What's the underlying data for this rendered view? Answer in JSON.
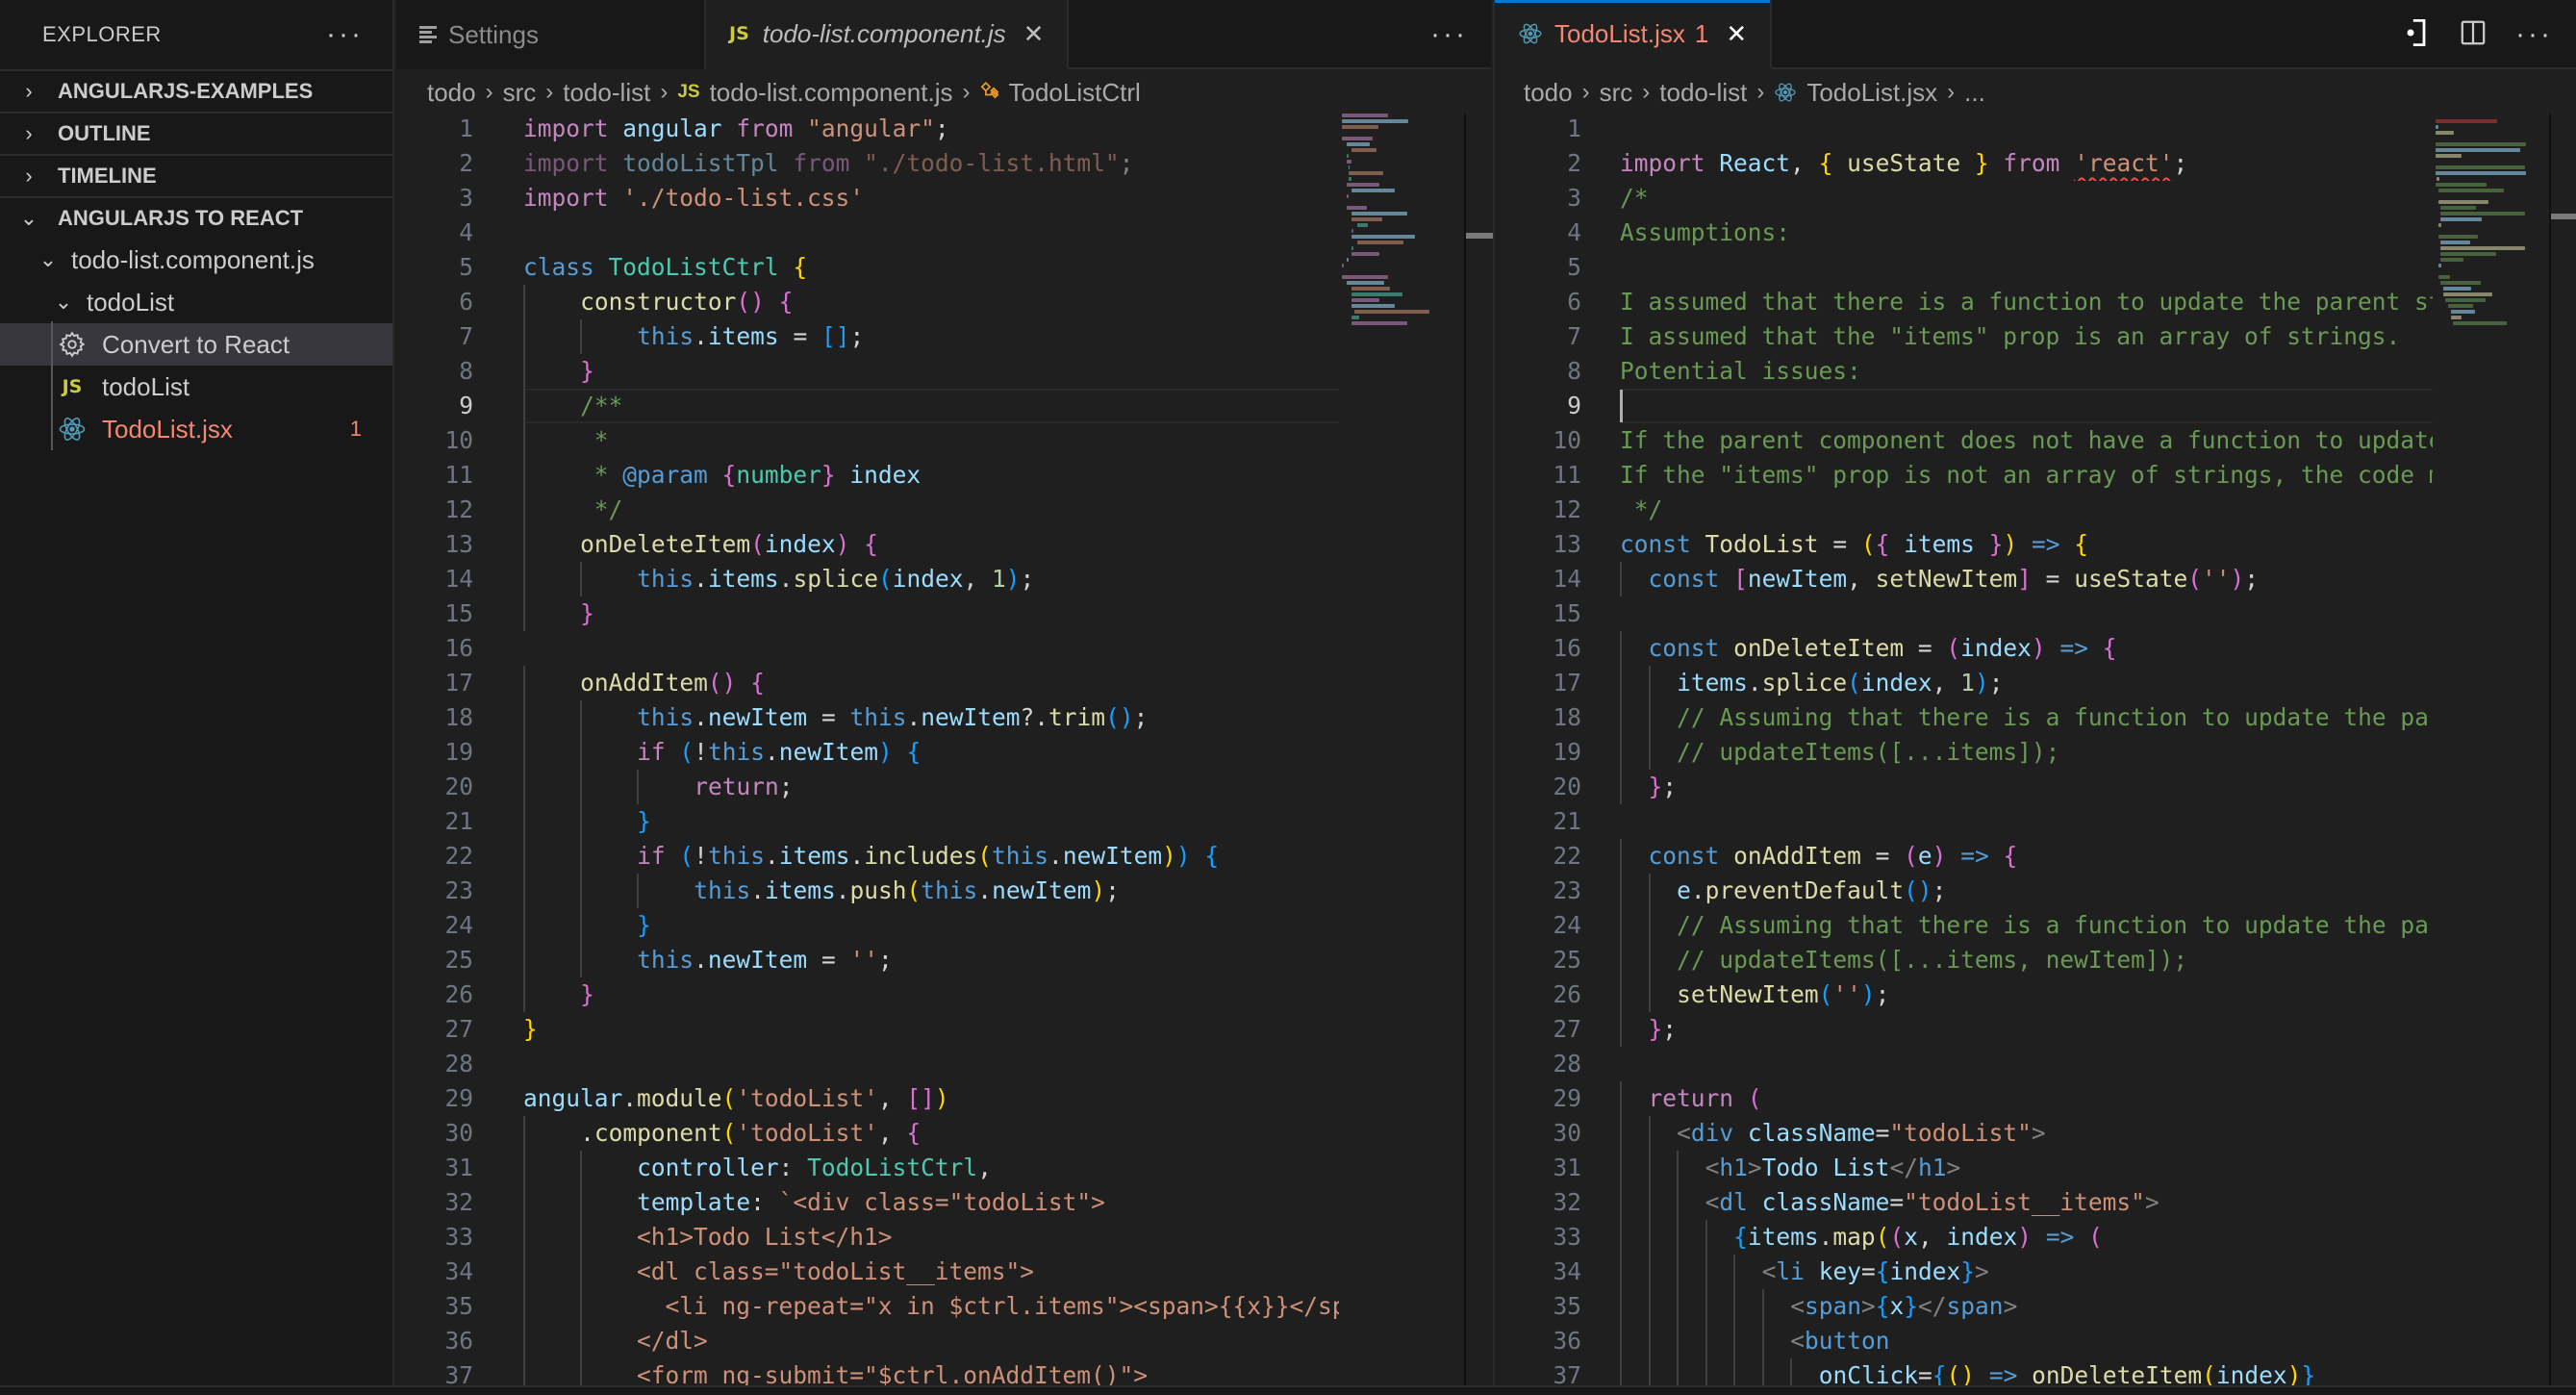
{
  "sidebar": {
    "title": "EXPLORER",
    "more_label": "···",
    "sections": [
      {
        "label": "ANGULARJS-EXAMPLES",
        "expanded": false
      },
      {
        "label": "OUTLINE",
        "expanded": false
      },
      {
        "label": "TIMELINE",
        "expanded": false
      },
      {
        "label": "ANGULARJS TO REACT",
        "expanded": true
      }
    ],
    "tree": [
      {
        "label": "todo-list.component.js",
        "icon": "chevron-down-icon",
        "level": 1
      },
      {
        "label": "todoList",
        "icon": "chevron-down-icon",
        "level": 2
      },
      {
        "label": "Convert to React",
        "icon": "gear-icon",
        "level": 3,
        "selected": true
      },
      {
        "label": "todoList",
        "icon": "js-file-icon",
        "icon_text": "JS",
        "level": 3
      },
      {
        "label": "TodoList.jsx",
        "icon": "react-icon",
        "level": 3,
        "error": true,
        "badge": "1"
      }
    ]
  },
  "left_editor": {
    "tabs": [
      {
        "label": "Settings",
        "icon": "settings-icon",
        "active": false
      },
      {
        "label": "todo-list.component.js",
        "icon": "js-file-icon",
        "icon_text": "JS",
        "active": true,
        "italic": true,
        "close": "✕"
      }
    ],
    "more_label": "···",
    "breadcrumb": [
      "todo",
      "src",
      "todo-list",
      "todo-list.component.js",
      "TodoListCtrl"
    ],
    "current_line": 9,
    "lines": [
      "import angular from \"angular\";",
      "import todoListTpl from \"./todo-list.html\";",
      "import './todo-list.css'",
      "",
      "class TodoListCtrl {",
      "    constructor() {",
      "        this.items = [];",
      "    }",
      "    /**",
      "     *",
      "     * @param {number} index",
      "     */",
      "    onDeleteItem(index) {",
      "        this.items.splice(index, 1);",
      "    }",
      "",
      "    onAddItem() {",
      "        this.newItem = this.newItem?.trim();",
      "        if (!this.newItem) {",
      "            return;",
      "        }",
      "        if (!this.items.includes(this.newItem)) {",
      "            this.items.push(this.newItem);",
      "        }",
      "        this.newItem = '';",
      "    }",
      "}",
      "",
      "angular.module('todoList', [])",
      "    .component('todoList', {",
      "        controller: TodoListCtrl,",
      "        template: `<div class=\"todoList\">",
      "        <h1>Todo List</h1>",
      "        <dl class=\"todoList__items\">",
      "          <li ng-repeat=\"x in $ctrl.items\"><span>{{x}}</spa",
      "        </dl>",
      "        <form ng-submit=\"$ctrl.onAddItem()\">"
    ]
  },
  "right_editor": {
    "tabs": [
      {
        "label": "TodoList.jsx",
        "icon": "react-icon",
        "active": true,
        "error_count": "1",
        "close": "✕"
      }
    ],
    "actions": [
      {
        "name": "open-changes-icon"
      },
      {
        "name": "split-editor-icon"
      },
      {
        "name": "more-actions-icon",
        "label": "···"
      }
    ],
    "breadcrumb": [
      "todo",
      "src",
      "todo-list",
      "TodoList.jsx",
      "..."
    ],
    "current_line": 9,
    "lines": [
      "",
      "import React, { useState } from 'react';",
      "/*",
      "Assumptions:",
      "",
      "I assumed that there is a function to update the parent sta",
      "I assumed that the \"items\" prop is an array of strings.",
      "Potential issues:",
      "",
      "If the parent component does not have a function to update",
      "If the \"items\" prop is not an array of strings, the code mi",
      " */",
      "const TodoList = ({ items }) => {",
      "  const [newItem, setNewItem] = useState('');",
      "",
      "  const onDeleteItem = (index) => {",
      "    items.splice(index, 1);",
      "    // Assuming that there is a function to update the pare",
      "    // updateItems([...items]);",
      "  };",
      "",
      "  const onAddItem = (e) => {",
      "    e.preventDefault();",
      "    // Assuming that there is a function to update the pare",
      "    // updateItems([...items, newItem]);",
      "    setNewItem('');",
      "  };",
      "",
      "  return (",
      "    <div className=\"todoList\">",
      "      <h1>Todo List</h1>",
      "      <dl className=\"todoList__items\">",
      "        {items.map((x, index) => (",
      "          <li key={index}>",
      "            <span>{x}</span>",
      "            <button",
      "              onClick={() => onDeleteItem(index)}"
    ]
  },
  "colors": {
    "accent": "#0078d4",
    "error": "#f48771",
    "js_badge": "#cbcb41",
    "react_icon": "#519aba",
    "editor_bg": "#1f1f1f",
    "sidebar_bg": "#181818"
  }
}
